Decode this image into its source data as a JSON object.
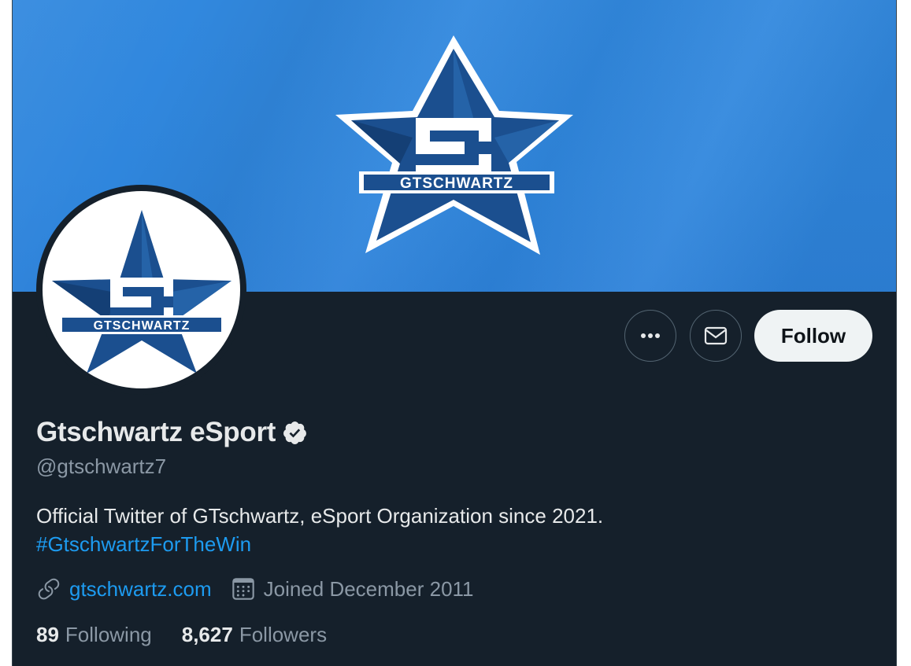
{
  "profile": {
    "display_name": "Gtschwartz eSport",
    "handle": "@gtschwartz7",
    "verified": true,
    "bio_text": "Official Twitter of GTschwartz, eSport Organization since 2021.",
    "bio_hashtag": "#GtschwartzForTheWin",
    "website": "gtschwartz.com",
    "joined": "Joined December 2011",
    "logo_text": "GTSCHWARTZ",
    "logo_letter": "S"
  },
  "stats": {
    "following_count": "89",
    "following_label": "Following",
    "followers_count": "8,627",
    "followers_label": "Followers"
  },
  "actions": {
    "follow_label": "Follow"
  },
  "icons": {
    "more": "more-horizontal-icon",
    "message": "envelope-icon",
    "verified": "verified-badge-icon",
    "link": "link-icon",
    "calendar": "calendar-icon"
  },
  "colors": {
    "background": "#15202b",
    "banner_blue": "#2f86dd",
    "star_dark": "#1b4f8f",
    "accent": "#1d9bf0",
    "text_primary": "#e7e9ea",
    "text_secondary": "#8b98a5",
    "follow_bg": "#eff3f4"
  }
}
